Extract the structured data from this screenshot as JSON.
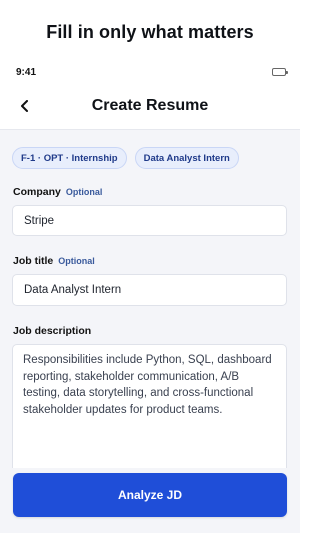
{
  "marketing": {
    "headline": "Fill in only what matters"
  },
  "statusbar": {
    "time": "9:41",
    "icon": "battery-icon"
  },
  "header": {
    "title": "Create Resume",
    "back_icon": "chevron-left-icon"
  },
  "chips": [
    {
      "label": "F-1 · OPT · Internship"
    },
    {
      "label": "Data Analyst Intern"
    }
  ],
  "form": {
    "company": {
      "label": "Company",
      "hint": "Optional",
      "value": "Stripe"
    },
    "job_title": {
      "label": "Job title",
      "hint": "Optional",
      "value": "Data Analyst Intern"
    },
    "job_description": {
      "label": "Job description",
      "value": "Responsibilities include Python, SQL, dashboard reporting, stakeholder communication, A/B testing, data storytelling, and cross-functional stakeholder updates for product teams."
    }
  },
  "cta": {
    "label": "Analyze JD"
  },
  "colors": {
    "accent": "#1f4ed8",
    "chip_bg": "#e8eefc",
    "screen_bg": "#f4f5f9"
  }
}
